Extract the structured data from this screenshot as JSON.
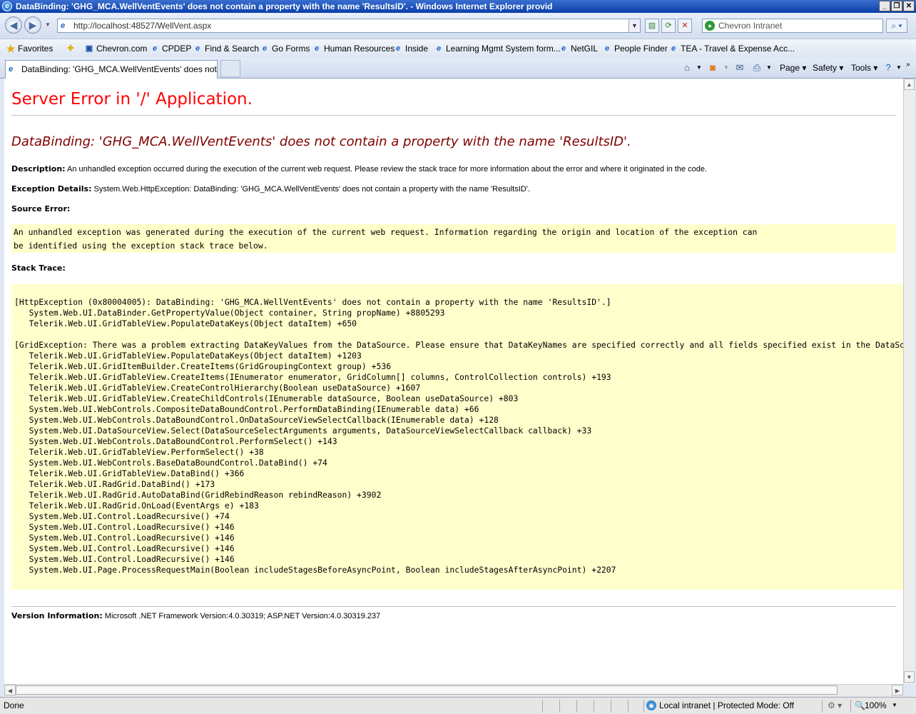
{
  "window": {
    "title": "DataBinding: 'GHG_MCA.WellVentEvents' does not contain a property with the name 'ResultsID'. - Windows Internet Explorer provid",
    "controls": [
      "_",
      "❐",
      "✕"
    ]
  },
  "navbar": {
    "back_icon": "back-arrow-icon",
    "forward_icon": "forward-arrow-icon",
    "url": "http://localhost:48527/WellVent.aspx",
    "search_provider": "Chevron Intranet"
  },
  "favorites": {
    "label": "Favorites",
    "items": [
      "Chevron.com",
      "CPDEP",
      "Find & Search",
      "Go Forms",
      "Human Resources",
      "Inside",
      "Learning Mgmt System form...",
      "NetGIL",
      "People Finder",
      "TEA - Travel & Expense Acc..."
    ]
  },
  "tab": {
    "label": "DataBinding: 'GHG_MCA.WellVentEvents' does not co..."
  },
  "commandbar": {
    "page": "Page",
    "safety": "Safety",
    "tools": "Tools"
  },
  "page": {
    "server_error_title": "Server Error in '/' Application.",
    "error_heading": "DataBinding: 'GHG_MCA.WellVentEvents' does not contain a property with the name 'ResultsID'.",
    "description_label": "Description:",
    "description_text": "An unhandled exception occurred during the execution of the current web request. Please review the stack trace for more information about the error and where it originated in the code.",
    "exception_label": "Exception Details:",
    "exception_text": "System.Web.HttpException: DataBinding: 'GHG_MCA.WellVentEvents' does not contain a property with the name 'ResultsID'.",
    "source_error_label": "Source Error:",
    "source_error_line1": "An unhandled exception was generated during the execution of the current web request. Information regarding the origin and location of the exception can",
    "source_error_line2": "be identified using the exception stack trace below.",
    "stack_trace_label": "Stack Trace:",
    "stack_trace": "[HttpException (0x80004005): DataBinding: 'GHG_MCA.WellVentEvents' does not contain a property with the name 'ResultsID'.]\n   System.Web.UI.DataBinder.GetPropertyValue(Object container, String propName) +8805293\n   Telerik.Web.UI.GridTableView.PopulateDataKeys(Object dataItem) +650\n\n[GridException: There was a problem extracting DataKeyValues from the DataSource. Please ensure that DataKeyNames are specified correctly and all fields specified exist in the DataSource.]\n   Telerik.Web.UI.GridTableView.PopulateDataKeys(Object dataItem) +1203\n   Telerik.Web.UI.GridItemBuilder.CreateItems(GridGroupingContext group) +536\n   Telerik.Web.UI.GridTableView.CreateItems(IEnumerator enumerator, GridColumn[] columns, ControlCollection controls) +193\n   Telerik.Web.UI.GridTableView.CreateControlHierarchy(Boolean useDataSource) +1607\n   Telerik.Web.UI.GridTableView.CreateChildControls(IEnumerable dataSource, Boolean useDataSource) +803\n   System.Web.UI.WebControls.CompositeDataBoundControl.PerformDataBinding(IEnumerable data) +66\n   System.Web.UI.WebControls.DataBoundControl.OnDataSourceViewSelectCallback(IEnumerable data) +128\n   System.Web.UI.DataSourceView.Select(DataSourceSelectArguments arguments, DataSourceViewSelectCallback callback) +33\n   System.Web.UI.WebControls.DataBoundControl.PerformSelect() +143\n   Telerik.Web.UI.GridTableView.PerformSelect() +38\n   System.Web.UI.WebControls.BaseDataBoundControl.DataBind() +74\n   Telerik.Web.UI.GridTableView.DataBind() +366\n   Telerik.Web.UI.RadGrid.DataBind() +173\n   Telerik.Web.UI.RadGrid.AutoDataBind(GridRebindReason rebindReason) +3902\n   Telerik.Web.UI.RadGrid.OnLoad(EventArgs e) +183\n   System.Web.UI.Control.LoadRecursive() +74\n   System.Web.UI.Control.LoadRecursive() +146\n   System.Web.UI.Control.LoadRecursive() +146\n   System.Web.UI.Control.LoadRecursive() +146\n   System.Web.UI.Control.LoadRecursive() +146\n   System.Web.UI.Page.ProcessRequestMain(Boolean includeStagesBeforeAsyncPoint, Boolean includeStagesAfterAsyncPoint) +2207",
    "version_label": "Version Information:",
    "version_text": "Microsoft .NET Framework Version:4.0.30319; ASP.NET Version:4.0.30319.237"
  },
  "statusbar": {
    "left": "Done",
    "zone": "Local intranet | Protected Mode: Off",
    "zoom": "100%"
  },
  "colors": {
    "title_red": "#ff0000",
    "heading_maroon": "#800000",
    "code_bg": "#ffffcc"
  }
}
